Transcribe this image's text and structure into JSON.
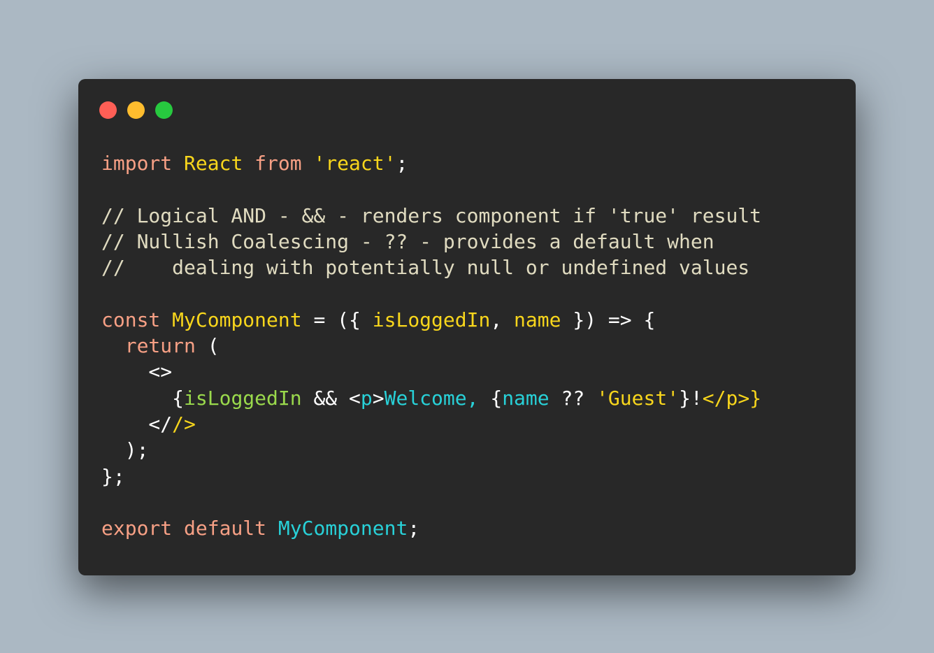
{
  "colors": {
    "background": "#abb8c3",
    "window": "#282828",
    "close_dot": "#ff5f56",
    "minimize_dot": "#ffbd2e",
    "maximize_dot": "#27c93f"
  },
  "window_controls": [
    {
      "name": "close",
      "icon": "circle",
      "color": "#ff5f56"
    },
    {
      "name": "minimize",
      "icon": "circle",
      "color": "#ffbd2e"
    },
    {
      "name": "maximize",
      "icon": "circle",
      "color": "#27c93f"
    }
  ],
  "code": {
    "language": "jsx",
    "lines": [
      [
        {
          "text": "import",
          "color": "#f7a085"
        },
        {
          "text": " ",
          "color": "#ffffff"
        },
        {
          "text": "React",
          "color": "#f8d61c"
        },
        {
          "text": " ",
          "color": "#ffffff"
        },
        {
          "text": "from",
          "color": "#f7a085"
        },
        {
          "text": " ",
          "color": "#ffffff"
        },
        {
          "text": "'react'",
          "color": "#f8d61c"
        },
        {
          "text": ";",
          "color": "#ffffff"
        }
      ],
      [],
      [
        {
          "text": "// Logical AND - && - renders component if 'true' result",
          "color": "#e0dbc0"
        }
      ],
      [
        {
          "text": "// Nullish Coalescing - ?? - provides a default when",
          "color": "#e0dbc0"
        }
      ],
      [
        {
          "text": "//    dealing with potentially null or undefined values",
          "color": "#e0dbc0"
        }
      ],
      [],
      [
        {
          "text": "const",
          "color": "#f7a085"
        },
        {
          "text": " ",
          "color": "#ffffff"
        },
        {
          "text": "MyComponent",
          "color": "#f8d61c"
        },
        {
          "text": " = ({ ",
          "color": "#ffffff"
        },
        {
          "text": "isLoggedIn",
          "color": "#f8d61c"
        },
        {
          "text": ", ",
          "color": "#ffffff"
        },
        {
          "text": "name",
          "color": "#f8d61c"
        },
        {
          "text": " }) => {",
          "color": "#ffffff"
        }
      ],
      [
        {
          "text": "  ",
          "color": "#ffffff"
        },
        {
          "text": "return",
          "color": "#f7a085"
        },
        {
          "text": " (",
          "color": "#ffffff"
        }
      ],
      [
        {
          "text": "    <>",
          "color": "#ffffff"
        }
      ],
      [
        {
          "text": "      {",
          "color": "#ffffff"
        },
        {
          "text": "isLoggedIn",
          "color": "#9ad94c"
        },
        {
          "text": " && <",
          "color": "#ffffff"
        },
        {
          "text": "p",
          "color": "#28d1d8"
        },
        {
          "text": ">",
          "color": "#ffffff"
        },
        {
          "text": "Welcome, ",
          "color": "#28d1d8"
        },
        {
          "text": "{",
          "color": "#ffffff"
        },
        {
          "text": "name",
          "color": "#28d1d8"
        },
        {
          "text": " ?? ",
          "color": "#ffffff"
        },
        {
          "text": "'Guest'",
          "color": "#f8d61c"
        },
        {
          "text": "}!",
          "color": "#ffffff"
        },
        {
          "text": "</",
          "color": "#f8d61c"
        },
        {
          "text": "p",
          "color": "#f8d61c"
        },
        {
          "text": ">}",
          "color": "#f8d61c"
        }
      ],
      [
        {
          "text": "    </",
          "color": "#ffffff"
        },
        {
          "text": "/>",
          "color": "#f8d61c"
        }
      ],
      [
        {
          "text": "  );",
          "color": "#ffffff"
        }
      ],
      [
        {
          "text": "};",
          "color": "#ffffff"
        }
      ],
      [],
      [
        {
          "text": "export",
          "color": "#f7a085"
        },
        {
          "text": " ",
          "color": "#ffffff"
        },
        {
          "text": "default",
          "color": "#f7a085"
        },
        {
          "text": " ",
          "color": "#ffffff"
        },
        {
          "text": "MyComponent",
          "color": "#28d1d8"
        },
        {
          "text": ";",
          "color": "#ffffff"
        }
      ]
    ]
  }
}
